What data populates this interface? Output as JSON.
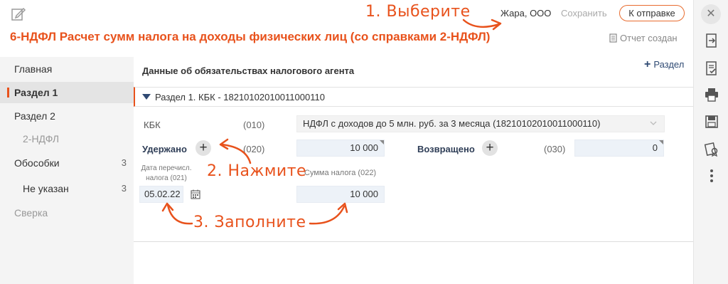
{
  "header": {
    "org_name": "Жара, ООО",
    "save_label": "Сохранить",
    "send_label": "К отправке"
  },
  "page": {
    "title": "6-НДФЛ Расчет сумм налога на доходы физических лиц (со справками 2-НДФЛ)",
    "report_status": "Отчет создан"
  },
  "sidebar": {
    "items": [
      {
        "label": "Главная",
        "count": ""
      },
      {
        "label": "Раздел 1",
        "count": ""
      },
      {
        "label": "Раздел 2",
        "count": ""
      },
      {
        "label": "2-НДФЛ",
        "count": ""
      },
      {
        "label": "Обособки",
        "count": "3"
      },
      {
        "label": "Не указан",
        "count": "3"
      },
      {
        "label": "Сверка",
        "count": ""
      }
    ]
  },
  "content": {
    "section_header": "Данные об обязательствах налогового агента",
    "add_section": "Раздел",
    "group_label": "Раздел 1. КБК - 18210102010011000110",
    "kbk_label": "КБК",
    "kbk_code": "(010)",
    "kbk_value": "НДФЛ с доходов до 5 млн. руб. за 3 месяца (18210102010011000110)",
    "withheld_label": "Удержано",
    "withheld_code": "(020)",
    "withheld_value": "10 000",
    "returned_label": "Возвращено",
    "returned_code": "(030)",
    "returned_value": "0",
    "date_label_line1": "Дата перечисл.",
    "date_label_line2": "налога (021)",
    "date_value": "05.02.22",
    "tax_sum_label": "Сумма налога (022)",
    "tax_sum_value": "10 000"
  },
  "annotations": {
    "step1": "1. Выберите",
    "step2": "2. Нажмите",
    "step3": "3. Заполните"
  },
  "colors": {
    "accent": "#e8521c",
    "navy": "#2f4a73",
    "input_bg": "#edf2f8",
    "sidebar_bg": "#f4f4f4"
  }
}
